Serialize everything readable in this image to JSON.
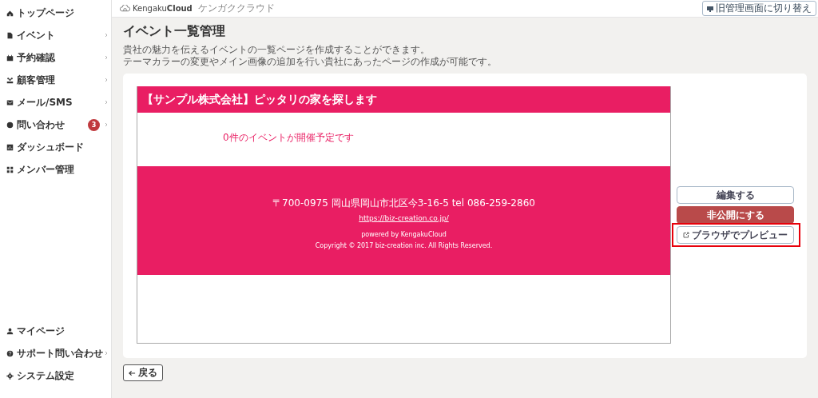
{
  "sidebar": {
    "items": [
      {
        "label": "トップページ",
        "expandable": false
      },
      {
        "label": "イベント",
        "expandable": true
      },
      {
        "label": "予約確認",
        "expandable": true
      },
      {
        "label": "顧客管理",
        "expandable": true
      },
      {
        "label": "メール/SMS",
        "expandable": true
      },
      {
        "label": "問い合わせ",
        "expandable": true,
        "badge": "3"
      },
      {
        "label": "ダッシュボード",
        "expandable": false
      },
      {
        "label": "メンバー管理",
        "expandable": false
      }
    ],
    "bottom_items": [
      {
        "label": "マイページ",
        "expandable": false
      },
      {
        "label": "サポート問い合わせ",
        "expandable": true
      },
      {
        "label": "システム設定",
        "expandable": false
      }
    ]
  },
  "header": {
    "logo": "KengakuCloud",
    "logo_sub": "ケンガククラウド",
    "switch_button": "旧管理画面に切り替え"
  },
  "page": {
    "title": "イベント一覧管理",
    "description": [
      "貴社の魅力を伝えるイベントの一覧ページを作成することができます。",
      "テーマカラーの変更やメイン画像の追加を行い貴社にあったページの作成が可能です。"
    ]
  },
  "preview": {
    "heading": "【サンプル株式会社】ピッタリの家を探します",
    "message": "0件のイベントが開催予定です",
    "address": "〒700-0975 岡山県岡山市北区今3-16-5 tel 086-259-2860",
    "url": "https://biz-creation.co.jp/",
    "powered": "powered by KengakuCloud",
    "copyright": "Copyright © 2017 biz-creation inc. All Rights Reserved."
  },
  "actions": [
    {
      "label": "編集する",
      "kind": "outline",
      "highlighted": false
    },
    {
      "label": "非公開にする",
      "kind": "danger",
      "highlighted": false
    },
    {
      "label": "ブラウザでプレビュー",
      "kind": "external",
      "highlighted": true
    }
  ],
  "back_button": "戻る"
}
